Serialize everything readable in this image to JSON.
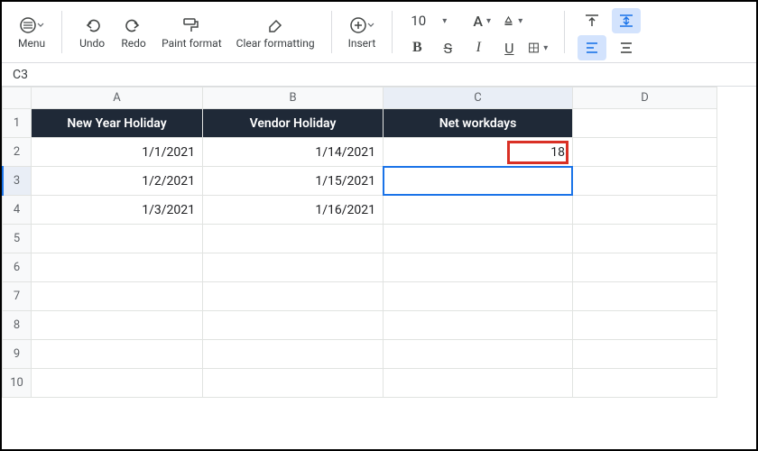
{
  "toolbar": {
    "menu_label": "Menu",
    "undo_label": "Undo",
    "redo_label": "Redo",
    "paintformat_label": "Paint format",
    "clearformat_label": "Clear formatting",
    "insert_label": "Insert",
    "font_size": "10"
  },
  "namebox": "C3",
  "columns": [
    "A",
    "B",
    "C",
    "D"
  ],
  "row_numbers": [
    "1",
    "2",
    "3",
    "4",
    "5",
    "6",
    "7",
    "8",
    "9",
    "10"
  ],
  "cells": {
    "A1": "New Year Holiday",
    "B1": "Vendor Holiday",
    "C1": "Net workdays",
    "A2": "1/1/2021",
    "B2": "1/14/2021",
    "C2": "18",
    "A3": "1/2/2021",
    "B3": "1/15/2021",
    "A4": "1/3/2021",
    "B4": "1/16/2021"
  },
  "selection": {
    "active_cell": "C3",
    "highlighted_result_cell": "C2"
  }
}
